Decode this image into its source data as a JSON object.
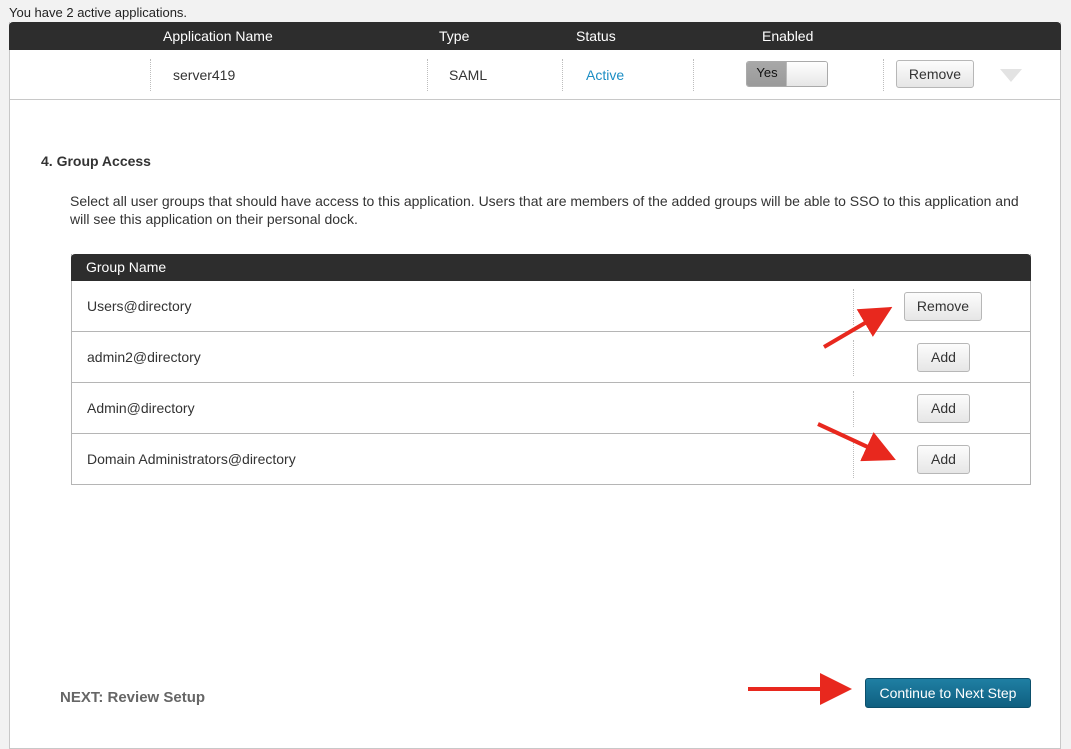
{
  "summary": "You have 2 active applications.",
  "app_table": {
    "columns": [
      "Application Name",
      "Type",
      "Status",
      "Enabled"
    ],
    "row": {
      "name": "server419",
      "type": "SAML",
      "status": "Active",
      "enabled_label": "Yes",
      "remove_label": "Remove"
    }
  },
  "group_access": {
    "title": "4. Group Access",
    "description": "Select all user groups that should have access to this application. Users that are members of the added groups will be able to SSO to this application and will see this application on their personal dock.",
    "column": "Group Name",
    "rows": [
      {
        "name": "Users@directory",
        "action": "Remove"
      },
      {
        "name": "admin2@directory",
        "action": "Add"
      },
      {
        "name": "Admin@directory",
        "action": "Add"
      },
      {
        "name": "Domain Administrators@directory",
        "action": "Add"
      }
    ]
  },
  "footer": {
    "next_label": "NEXT: Review Setup",
    "continue_label": "Continue to Next Step"
  },
  "colors": {
    "header_bg": "#2d2d2d",
    "status_active": "#1c8ec4",
    "primary_button": "#1a7196",
    "annotation_arrow": "#e8281e"
  },
  "icons": {
    "expand": "chevron-down-icon",
    "annotation": "red-arrow-icon"
  }
}
